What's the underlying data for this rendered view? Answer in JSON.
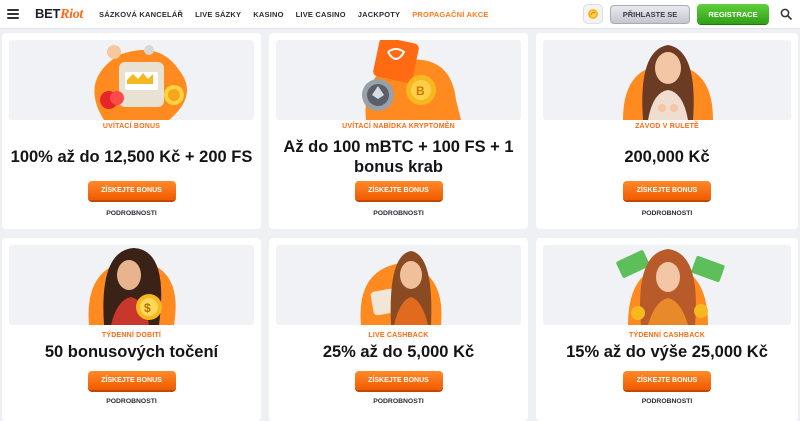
{
  "header": {
    "logo_part1": "BET",
    "logo_part2": "Riot",
    "nav": [
      "SÁZKOVÁ KANCELÁŘ",
      "LIVE SÁZKY",
      "KASINO",
      "LIVE CASINO",
      "JACKPOTY",
      "PROPAGAČNÍ AKCE"
    ],
    "active_nav": "PROPAGAČNÍ AKCE",
    "login_label": "PŘIHLASTE SE",
    "register_label": "REGISTRACE"
  },
  "colors": {
    "accent": "#ff6a12",
    "register": "#3ab422",
    "text": "#141418"
  },
  "promos": [
    {
      "kicker": "UVÍTACÍ BONUS",
      "headline": "100% až do 12,500 Kč + 200 FS",
      "cta": "ZÍSKEJTE BONUS",
      "details": "PODROBNOSTI",
      "icon": "slot-machine-crown-icon"
    },
    {
      "kicker": "UVÍTACÍ NABÍDKA KRYPTOMĚN",
      "headline": "Až do 100 mBTC + 100 FS + 1 bonus krab",
      "cta": "ZÍSKEJTE BONUS",
      "details": "PODROBNOSTI",
      "icon": "crypto-coins-icon"
    },
    {
      "kicker": "ZÁVOD V RULETĚ",
      "headline": "200,000 Kč",
      "cta": "ZÍSKEJTE BONUS",
      "details": "PODROBNOSTI",
      "icon": "woman-portrait-icon"
    },
    {
      "kicker": "TÝDENNÍ DOBITÍ",
      "headline": "50 bonusových točení",
      "cta": "ZÍSKEJTE BONUS",
      "details": "PODROBNOSTI",
      "icon": "woman-coin-icon"
    },
    {
      "kicker": "LIVE CASHBACK",
      "headline": "25% až do 5,000 Kč",
      "cta": "ZÍSKEJTE BONUS",
      "details": "PODROBNOSTI",
      "icon": "woman-slot-icon"
    },
    {
      "kicker": "TÝDENNÍ CASHBACK",
      "headline": "15% až do výše 25,000 Kč",
      "cta": "ZÍSKEJTE BONUS",
      "details": "PODROBNOSTI",
      "icon": "woman-cash-icon"
    }
  ]
}
